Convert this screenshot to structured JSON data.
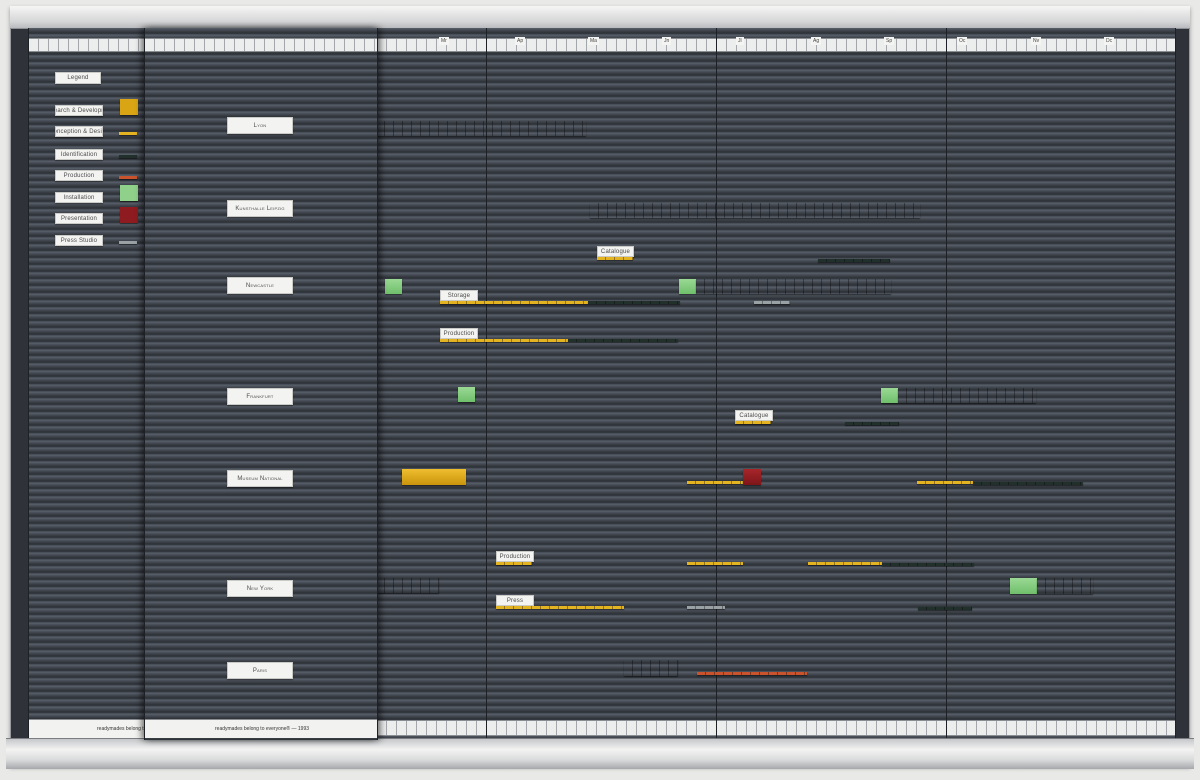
{
  "legend": {
    "title": "Legend",
    "items": [
      {
        "label": "Research & Development",
        "color": "#d9a514",
        "kind": "block"
      },
      {
        "label": "Conception & Design",
        "color": "#e3b321",
        "kind": "line"
      },
      {
        "label": "Identification",
        "color": "#22302c",
        "kind": "line"
      },
      {
        "label": "Production",
        "color": "#c8532c",
        "kind": "line"
      },
      {
        "label": "Installation",
        "color": "#8fd18a",
        "kind": "block"
      },
      {
        "label": "Presentation",
        "color": "#8e1b1f",
        "kind": "block"
      },
      {
        "label": "Press Studio",
        "color": "#9aa1a5",
        "kind": "line"
      }
    ]
  },
  "locations": [
    "Lyon",
    "Kunsthalle Leipzig",
    "Newcastle",
    "Frankfurt",
    "Museum National",
    "New York",
    "Paris"
  ],
  "months": [
    "Mr",
    "Ap",
    "Ma",
    "Jn",
    "Jl",
    "Ag",
    "Sp",
    "Oc",
    "Nv",
    "Dc"
  ],
  "tags": [
    "Catalogue",
    "Storage",
    "Production",
    "Catalogue",
    "Production",
    "Press"
  ],
  "footer": {
    "left": "readymades belong to",
    "main": "readymades belong to everyone® — 1993"
  },
  "colors": {
    "board": "#2f3339",
    "presentation": "#8e1b1f",
    "research": "#d9a514",
    "installation": "#8fd18a",
    "label_paper": "#f3f3f1"
  }
}
